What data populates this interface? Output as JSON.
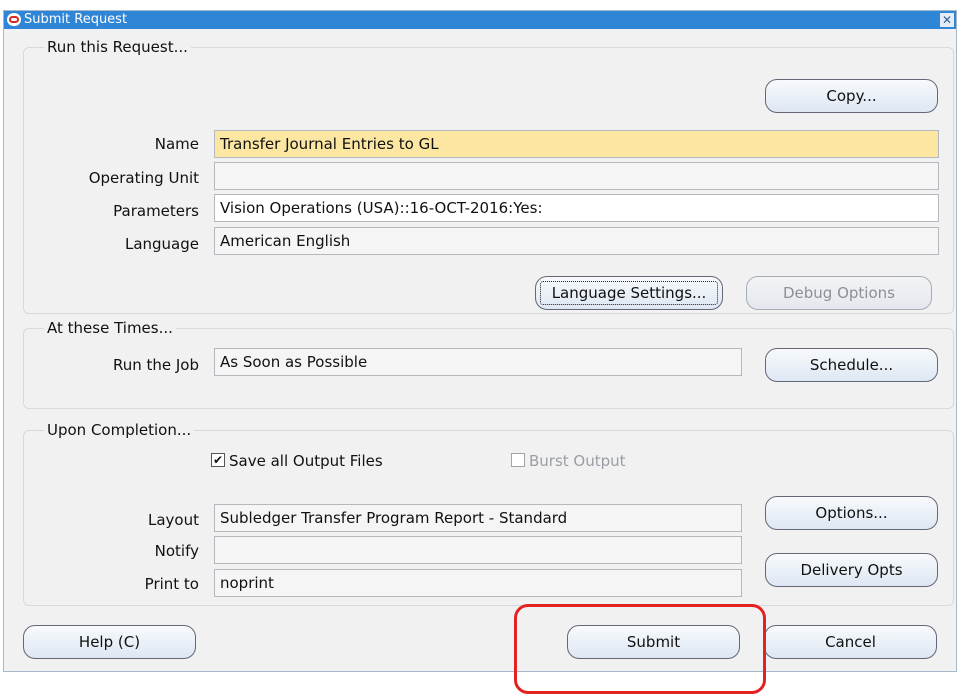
{
  "window": {
    "title": "Submit Request",
    "close_glyph": "✕"
  },
  "run_section": {
    "title": "Run this Request...",
    "copy_button": "Copy...",
    "name_label": "Name",
    "name_value": "Transfer Journal Entries to GL",
    "operating_unit_label": "Operating Unit",
    "operating_unit_value": "",
    "parameters_label": "Parameters",
    "parameters_value": "Vision Operations (USA)::16-OCT-2016:Yes:",
    "language_label": "Language",
    "language_value": "American English",
    "language_settings_button": "Language Settings...",
    "debug_options_button": "Debug Options"
  },
  "times_section": {
    "title": "At these Times...",
    "run_job_label": "Run the Job",
    "run_job_value": "As Soon as Possible",
    "schedule_button": "Schedule..."
  },
  "completion_section": {
    "title": "Upon Completion...",
    "save_output_label": "Save all Output Files",
    "save_output_checked": true,
    "burst_output_label": "Burst Output",
    "burst_output_checked": false,
    "layout_label": "Layout",
    "layout_value": "Subledger Transfer Program Report - Standard",
    "options_button": "Options...",
    "notify_label": "Notify",
    "notify_value": "",
    "print_to_label": "Print to",
    "print_to_value": "noprint",
    "delivery_opts_button": "Delivery Opts"
  },
  "footer": {
    "help_button": "Help (C)",
    "submit_button": "Submit",
    "cancel_button": "Cancel"
  },
  "colors": {
    "titlebar": "#2f85d6",
    "name_field": "#fbe6a2",
    "highlight": "#e32222"
  },
  "icons": {
    "app_logo": "oracle-logo-icon",
    "check_mark": "✔"
  }
}
